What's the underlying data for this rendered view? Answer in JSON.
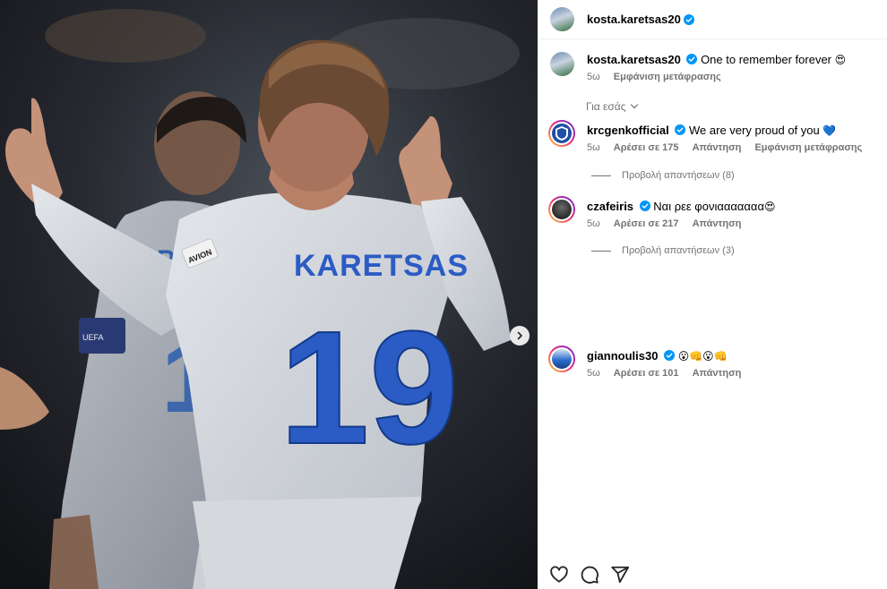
{
  "post": {
    "username": "kosta.karetsas20",
    "jersey_name": "KARETSAS",
    "jersey_number": "19",
    "sponsor_patch": "AVION",
    "armband_text": "UEFA"
  },
  "caption": {
    "username": "kosta.karetsas20",
    "text": "One to remember forever",
    "emoji": "😍",
    "time": "5ω",
    "see_translation": "Εμφάνιση μετάφρασης"
  },
  "sort_label": "Για εσάς",
  "comments": [
    {
      "username": "krcgenkofficial",
      "text": "We are very proud of you",
      "emoji": "💙",
      "time": "5ω",
      "likes": "Αρέσει σε 175",
      "reply": "Απάντηση",
      "see_translation": "Εμφάνιση μετάφρασης",
      "view_replies": "Προβολή απαντήσεων (8)"
    },
    {
      "username": "czafeiris",
      "text": "Ναι ρεε φονιααααααα",
      "emoji": "😍",
      "time": "5ω",
      "likes": "Αρέσει σε 217",
      "reply": "Απάντηση",
      "view_replies": "Προβολή απαντήσεων (3)"
    },
    {
      "username": "giannoulis30",
      "emoji": "😮👊😮👊",
      "time": "5ω",
      "likes": "Αρέσει σε 101",
      "reply": "Απάντηση"
    }
  ],
  "colors": {
    "verified": "#0095f6",
    "muted_text": "#737373",
    "genk_blue": "#1f4fa8"
  },
  "icons": [
    "verified-icon",
    "chevron-down-icon",
    "chevron-right-icon",
    "heart-icon",
    "comment-icon",
    "share-icon"
  ]
}
